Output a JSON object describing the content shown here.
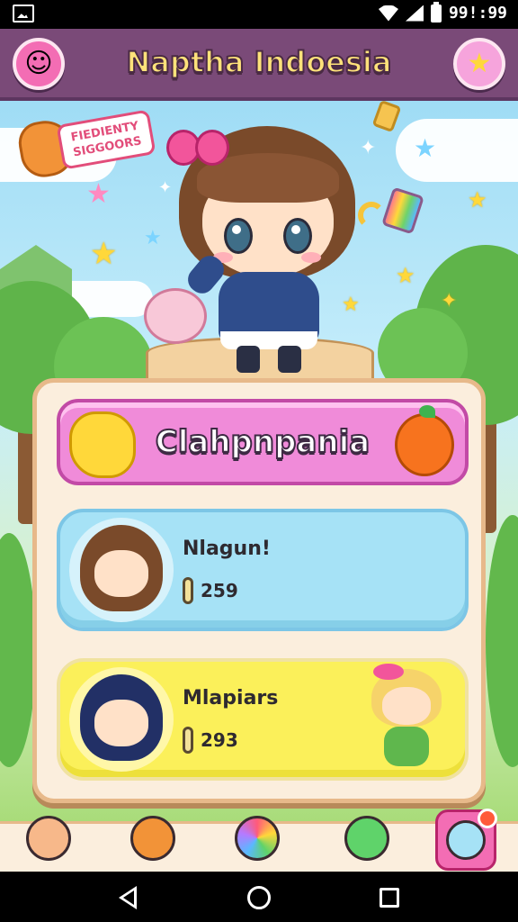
{
  "status_bar": {
    "time": "99!:99",
    "icons": [
      "image-icon",
      "wifi-icon",
      "signal-icon",
      "battery-icon"
    ]
  },
  "header": {
    "title": "Naptha Indoesia",
    "left_button_icon": "emoji-badge-icon",
    "right_button_icon": "star-icon"
  },
  "scene": {
    "sign_text_line1": "FIEDIENTY",
    "sign_text_line2": "SIGGOORS"
  },
  "panel": {
    "banner_title": "Clahpnpania",
    "cards": [
      {
        "name": "Nlagun!",
        "score": "259",
        "color": "blue"
      },
      {
        "name": "Mlapiars",
        "score": "293",
        "color": "yellow"
      }
    ]
  },
  "bottom_nav": {
    "items": [
      "avatar-tab-icon",
      "bear-tab-icon",
      "rainbow-tab-icon",
      "slime-tab-icon",
      "profile-tab-icon"
    ]
  },
  "colors": {
    "header_bg": "#7a4a78",
    "title_gold": "#ffe27a",
    "banner_pink": "#f08bd9",
    "card_blue": "#a6e2f6",
    "card_yellow": "#fbf05a"
  }
}
